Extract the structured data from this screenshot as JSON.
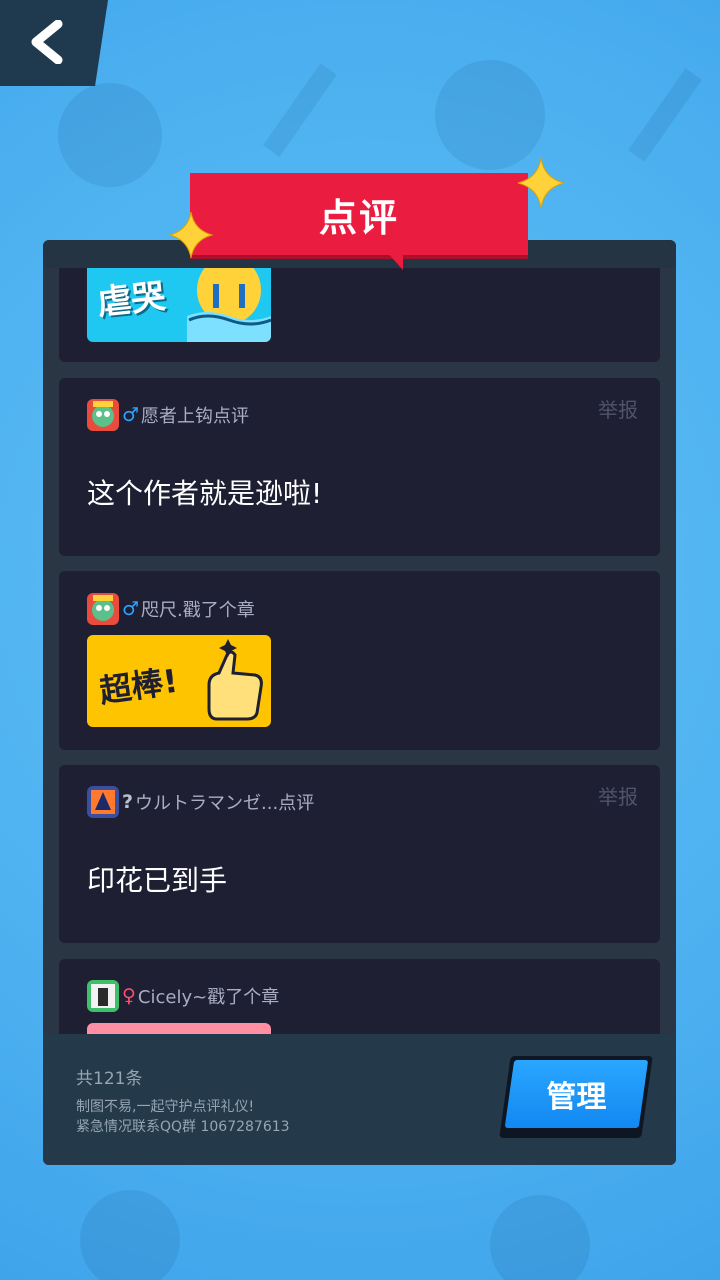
{
  "header": {
    "back_icon": "back-arrow-icon",
    "title": "点评"
  },
  "comments": [
    {
      "type": "sticker",
      "sticker_text": "虐哭",
      "sticker_color": "#1fc8f0"
    },
    {
      "type": "text",
      "user": "愿者上钩点评",
      "gender": "♂",
      "gender_color": "#2ea3ff",
      "text": "这个作者就是逊啦!",
      "report": "举报"
    },
    {
      "type": "sticker",
      "user": "咫尺.戳了个章",
      "gender": "♂",
      "gender_color": "#2ea3ff",
      "sticker_text": "超棒!",
      "sticker_color": "#ffc400"
    },
    {
      "type": "text",
      "user": "ウルトラマンゼ...点评",
      "gender": "?",
      "gender_color": "#b9c0cf",
      "text": "印花已到手",
      "report": "举报"
    },
    {
      "type": "sticker",
      "user": "Cicely~戳了个章",
      "gender": "♀",
      "gender_color": "#ff4d6d",
      "sticker_color": "#ff8fa3"
    }
  ],
  "footer": {
    "count": "共121条",
    "notice_line1": "制图不易,一起守护点评礼仪!",
    "notice_line2": "紧急情况联系QQ群 1067287613",
    "manage_label": "管理"
  },
  "colors": {
    "background": "#4eb2f1",
    "panel": "#2a3644",
    "card": "#1e1f33",
    "banner": "#ea1c3f",
    "manage_button": "#1a96f8"
  }
}
